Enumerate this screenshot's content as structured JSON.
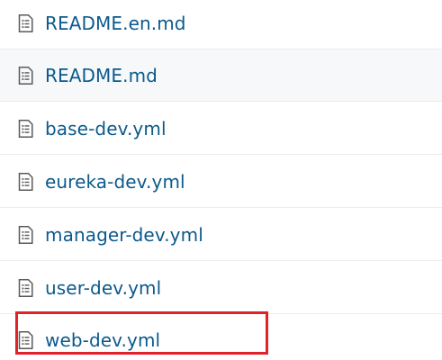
{
  "files": [
    {
      "name": "README.en.md",
      "icon": "file-text-icon"
    },
    {
      "name": "README.md",
      "icon": "file-text-icon"
    },
    {
      "name": "base-dev.yml",
      "icon": "file-text-icon"
    },
    {
      "name": "eureka-dev.yml",
      "icon": "file-text-icon"
    },
    {
      "name": "manager-dev.yml",
      "icon": "file-text-icon"
    },
    {
      "name": "user-dev.yml",
      "icon": "file-text-icon"
    },
    {
      "name": "web-dev.yml",
      "icon": "file-text-icon"
    }
  ],
  "hovered_row": 1,
  "highlighted_row": 6,
  "colors": {
    "link": "#0b5a8c",
    "highlight": "#e0222a",
    "hover_bg": "#f6f8fa",
    "border": "#eaecef",
    "icon": "#5a5a5a"
  }
}
